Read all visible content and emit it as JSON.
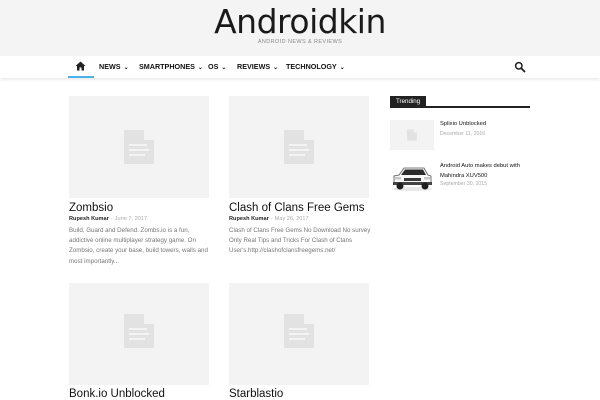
{
  "site": {
    "title": "Androidkin",
    "tagline": "ANDROID NEWS & REVIEWS"
  },
  "nav": {
    "home_icon": "home-icon",
    "search_icon": "search-icon",
    "items": [
      {
        "label": "NEWS"
      },
      {
        "label": "SMARTPHONES"
      },
      {
        "label": "OS"
      },
      {
        "label": "REVIEWS"
      },
      {
        "label": "TECHNOLOGY"
      }
    ],
    "chevron": "⌄"
  },
  "posts": [
    {
      "title": "Zombsio",
      "author": "Rupesh Kumar",
      "date": "June 7, 2017",
      "excerpt": "Build, Guard and Defend. Zombs.io is a fun, addictive online multiplayer strategy game. On Zombsio, create your base, build towers, walls and most importantly..."
    },
    {
      "title": "Clash of Clans Free Gems",
      "author": "Rupesh Kumar",
      "date": "May 26, 2017",
      "excerpt": "Clash of Clans Free Gems No Download No survey Only Real Tips and Tricks For Clash of Clans User's.http://clashofclansfreegems.net/"
    },
    {
      "title": "Bonk.io Unblocked"
    },
    {
      "title": "Starblastio"
    }
  ],
  "trending": {
    "label": "Trending",
    "items": [
      {
        "title": "Splixio Unblocked",
        "date": "December 11, 2016"
      },
      {
        "title": "Android Auto makes debut with Mahindra XUV500",
        "date": "September 30, 2015"
      }
    ]
  },
  "colors": {
    "accent": "#4db2ec",
    "masthead_bg": "#f4f4f4",
    "placeholder_bg": "#f3f3f3",
    "trending_bg": "#222222"
  }
}
